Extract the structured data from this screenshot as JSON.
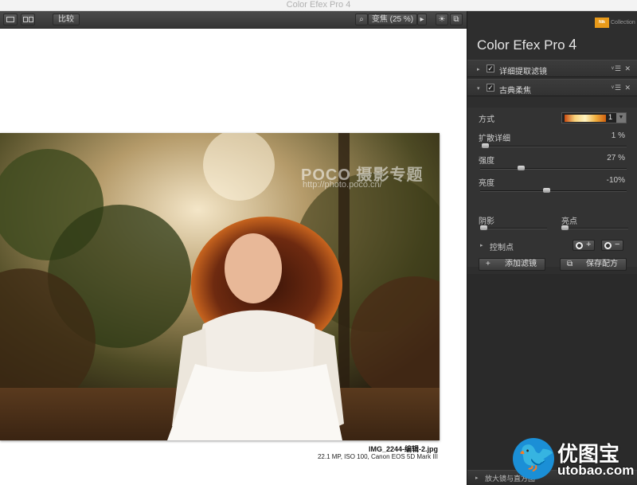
{
  "window": {
    "title": "Color Efex Pro 4"
  },
  "toolbar": {
    "compare_label": "比较",
    "zoom_label": "变焦 (25 %)",
    "zoom_arrow": "▸"
  },
  "image": {
    "watermark": "POCO 摄影专题",
    "watermark_url": "http://photo.poco.cn/",
    "filename": "IMG_2244-编辑-2.jpg",
    "info": "22.1 MP, ISO 100, Canon EOS 5D Mark III"
  },
  "panel": {
    "brand_logo": "Nik",
    "brand_text": "Collection",
    "title": "Color Efex Pro",
    "version": "4",
    "filters": [
      {
        "label": "详细提取滤镜",
        "checked": "✓",
        "expanded": "▸",
        "controls": "ᵛ☰ ✕"
      },
      {
        "label": "古典柔焦",
        "checked": "✓",
        "expanded": "▾",
        "controls": "ᵛ☰ ✕"
      }
    ],
    "params": {
      "method_label": "方式",
      "method_value": "1",
      "diffuse_label": "扩散详细",
      "diffuse_value": "1 %",
      "diffuse_level": 1,
      "strength_label": "强度",
      "strength_value": "27 %",
      "strength_level": 27,
      "brightness_label": "亮度",
      "brightness_value": "-10%",
      "brightness_level": -10,
      "shadows_label": "阴影",
      "highlights_label": "亮点"
    },
    "control_points_label": "控制点",
    "add_filter_label": "添加滤镜",
    "save_recipe_label": "保存配方",
    "bottom_label": "放大镜与直方图"
  },
  "site_watermark": {
    "cn": "优图宝",
    "en": "utobao.com"
  },
  "colors": {
    "panel_bg": "#2e2e2e",
    "accent_orange": "#e89a1a",
    "logo_blue": "#1b8fd6"
  }
}
